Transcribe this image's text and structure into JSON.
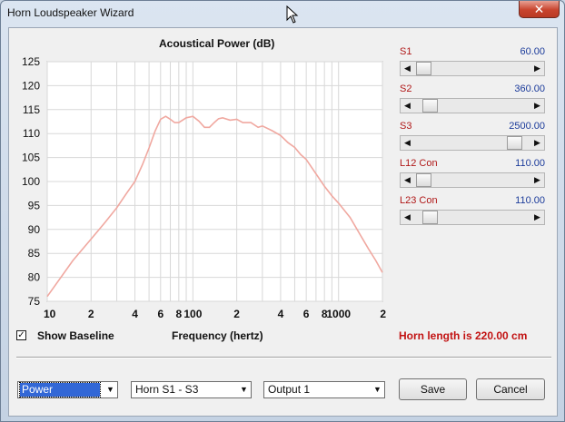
{
  "window": {
    "title": "Horn Loudspeaker Wizard",
    "close_glyph": "✕"
  },
  "chart": {
    "title": "Acoustical Power (dB)",
    "y_ticks": [
      "125",
      "120",
      "115",
      "110",
      "105",
      "100",
      "95",
      "90",
      "85",
      "80",
      "75"
    ],
    "x_ticks": [
      "10",
      "2",
      "4",
      "6",
      "8",
      "100",
      "2",
      "4",
      "6",
      "8",
      "1000",
      "2"
    ],
    "x_title": "Frequency (hertz)"
  },
  "chart_data": {
    "type": "line",
    "title": "Acoustical Power (dB)",
    "xlabel": "Frequency (hertz)",
    "ylabel": "",
    "xscale": "log",
    "xlim": [
      10,
      2000
    ],
    "ylim": [
      75,
      125
    ],
    "grid": true,
    "series": [
      {
        "color": "#f0a8a0",
        "x": [
          10,
          15,
          20,
          25,
          30,
          35,
          40,
          45,
          50,
          55,
          60,
          65,
          70,
          75,
          80,
          90,
          100,
          110,
          120,
          130,
          140,
          150,
          160,
          180,
          200,
          220,
          250,
          280,
          300,
          350,
          400,
          450,
          500,
          550,
          600,
          700,
          800,
          900,
          1000,
          1200,
          1400,
          1600,
          1800,
          2000
        ],
        "y": [
          76,
          83.5,
          88,
          91.5,
          94.5,
          97.5,
          100,
          103.5,
          107,
          110.5,
          113,
          113.6,
          113,
          112.3,
          112.3,
          113.3,
          113.6,
          112.6,
          111.3,
          111.3,
          112.3,
          113.1,
          113.3,
          112.8,
          113,
          112.3,
          112.3,
          111.3,
          111.6,
          110.6,
          109.6,
          108.1,
          107.1,
          105.6,
          104.6,
          101.6,
          99,
          97,
          95.5,
          92.5,
          89,
          86,
          83.5,
          81
        ]
      }
    ]
  },
  "sliders": [
    {
      "label": "S1",
      "value": "60.00",
      "position": 0.02
    },
    {
      "label": "S2",
      "value": "360.00",
      "position": 0.08
    },
    {
      "label": "S3",
      "value": "2500.00",
      "position": 0.92
    },
    {
      "label": "L12 Con",
      "value": "110.00",
      "position": 0.02
    },
    {
      "label": "L23 Con",
      "value": "110.00",
      "position": 0.08
    }
  ],
  "show_baseline": {
    "label": "Show Baseline",
    "checked": true,
    "check_glyph": "✓"
  },
  "horn_length_text": "Horn length is 220.00 cm",
  "combos": {
    "output_type": "Power",
    "horn_section": "Horn S1 - S3",
    "output_port": "Output 1",
    "arrow_glyph": "▼"
  },
  "buttons": {
    "save": "Save",
    "cancel": "Cancel"
  },
  "scroll_glyphs": {
    "left": "◀",
    "right": "▶"
  }
}
